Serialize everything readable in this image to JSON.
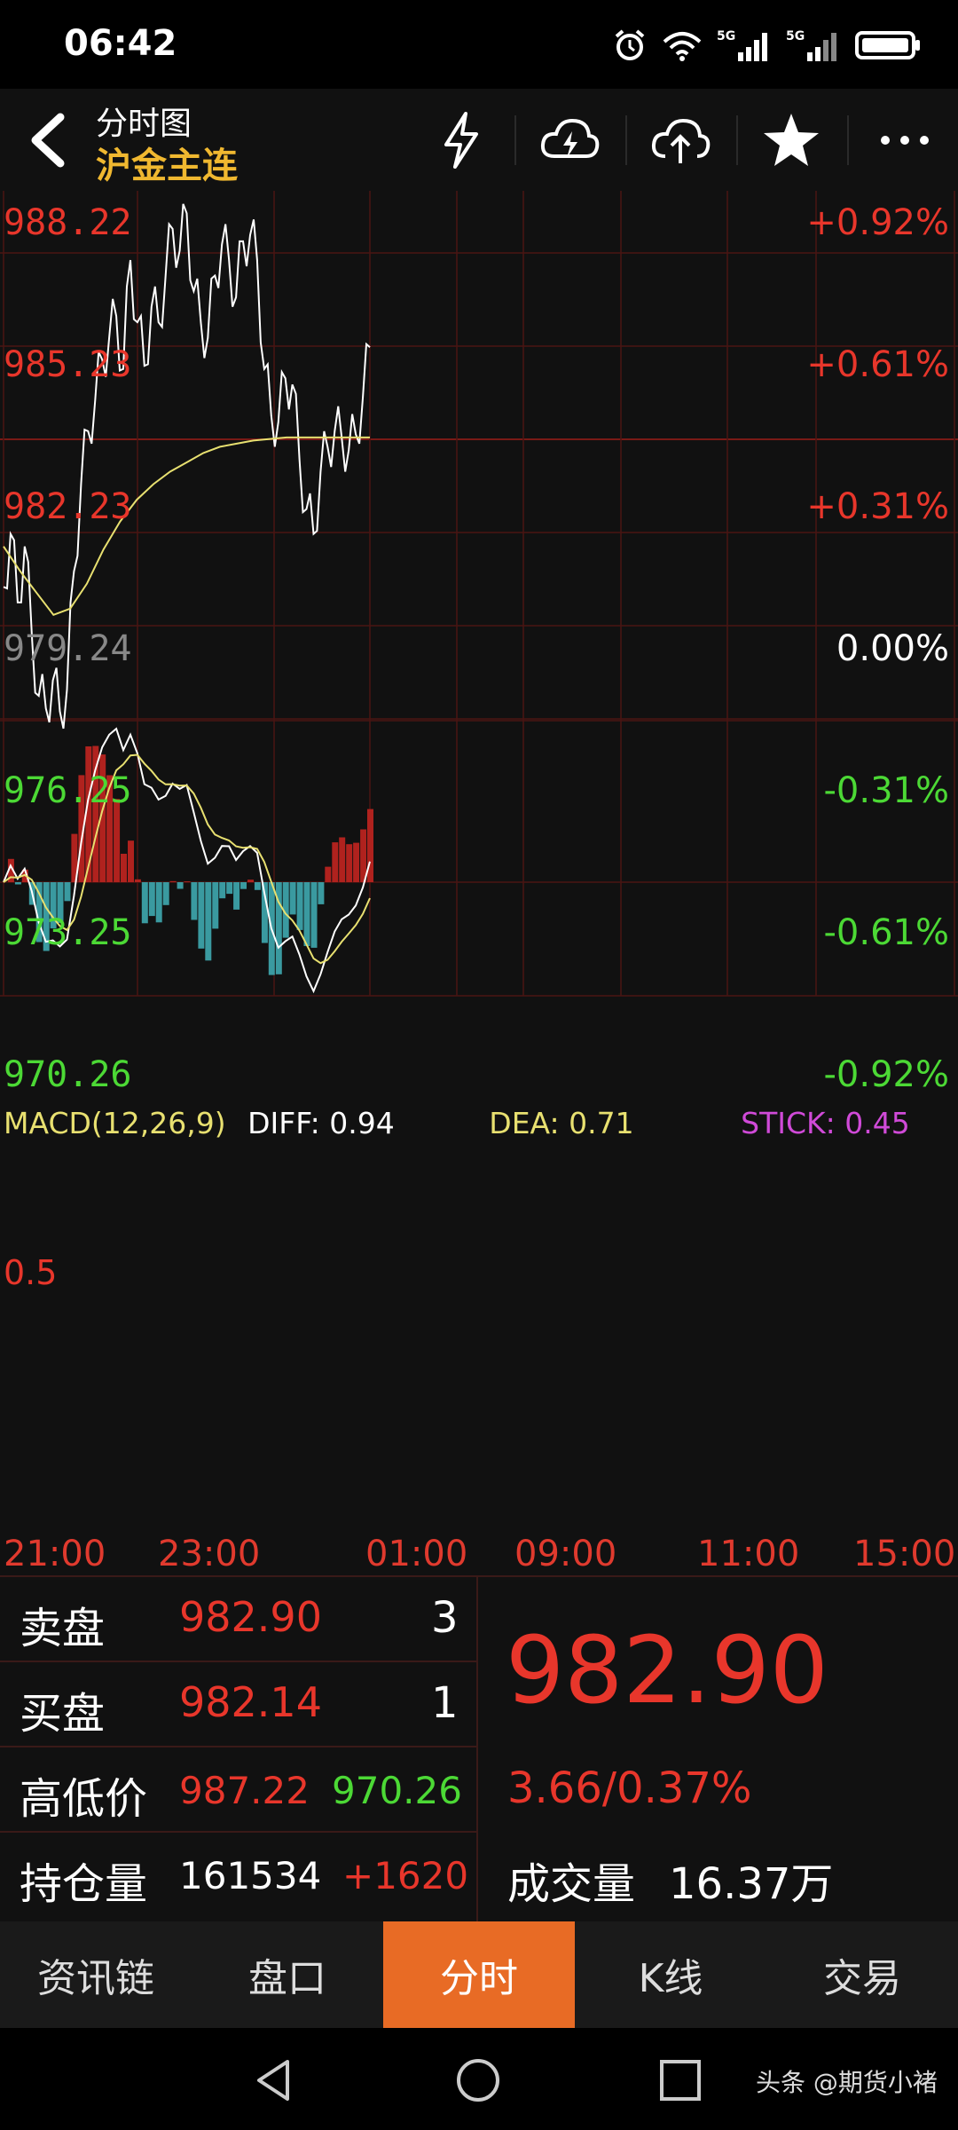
{
  "status": {
    "time": "06:42"
  },
  "header": {
    "title": "分时图",
    "instrument": "沪金主连"
  },
  "icons": {
    "back": "back-arrow-icon",
    "flash": "lightning-icon",
    "cloud_upload": "cloud-lightning-icon",
    "cloud_sync": "cloud-upload-icon",
    "favorite": "star-icon",
    "more": "more-icon"
  },
  "price_axis": {
    "left": [
      "988.22",
      "985.23",
      "982.23",
      "979.24",
      "976.25",
      "973.25",
      "970.26"
    ],
    "right": [
      "+0.92%",
      "+0.61%",
      "+0.31%",
      "0.00%",
      "-0.31%",
      "-0.61%",
      "-0.92%"
    ]
  },
  "macd": {
    "name": "MACD(12,26,9)",
    "diff": "DIFF: 0.94",
    "dea": "DEA: 0.71",
    "stick": "STICK: 0.45",
    "level": "0.5"
  },
  "time_axis": [
    "21:00",
    "23:00",
    "01:00",
    "09:00",
    "11:00",
    "15:00"
  ],
  "quote": {
    "sell_label": "卖盘",
    "sell_price": "982.90",
    "sell_vol": "3",
    "buy_label": "买盘",
    "buy_price": "982.14",
    "buy_vol": "1",
    "hl_label": "高低价",
    "high": "987.22",
    "low": "970.26",
    "oi_label": "持仓量",
    "oi": "161534",
    "oi_change": "+1620",
    "last": "982.90",
    "change": "3.66/0.37%",
    "volume_label": "成交量",
    "volume": "16.37万"
  },
  "tabs": [
    "资讯链",
    "盘口",
    "分时",
    "K线",
    "交易"
  ],
  "watermark": "头条 @期货小褚",
  "colors": {
    "up": "#e8362b",
    "down": "#4cd935",
    "accent": "#e86b25",
    "gold": "#f0b830",
    "avg_line": "#e8e070",
    "stick_pos": "#b0221e",
    "stick_neg": "#3a9aa0"
  },
  "chart_data": {
    "type": "line",
    "title": "",
    "ylim": [
      970.26,
      988.22
    ],
    "reference_price": 979.24,
    "series": [
      {
        "name": "",
        "values": [
          974.5,
          976.2,
          974.0,
          975.8,
          973.0,
          971.0,
          970.6,
          971.5,
          970.5,
          971.2,
          975.0,
          977.8,
          979.5,
          980.5,
          981.8,
          982.5,
          983.2,
          981.5,
          985.0,
          983.0,
          981.6,
          983.5,
          983.0,
          984.5,
          986.0,
          985.3,
          986.5,
          984.0,
          983.0,
          982.5,
          984.5,
          985.5,
          985.0,
          983.8,
          985.6,
          985.8,
          985.0,
          981.5,
          980.0,
          979.8,
          981.2,
          981.0,
          978.6,
          977.0,
          976.2,
          978.2,
          979.0,
          979.5,
          979.3,
          978.9,
          979.4,
          980.6,
          982.2
        ]
      },
      {
        "name": "",
        "values": [
          975.8,
          975.0,
          974.3,
          973.6,
          973.8,
          974.6,
          975.7,
          976.6,
          977.3,
          977.8,
          978.2,
          978.5,
          978.8,
          979.0,
          979.1,
          979.2,
          979.25,
          979.3,
          979.3,
          979.3,
          979.3,
          979.3,
          979.3
        ]
      }
    ],
    "macd": {
      "diff": 0.94,
      "dea": 0.71,
      "stick": 0.45
    }
  }
}
